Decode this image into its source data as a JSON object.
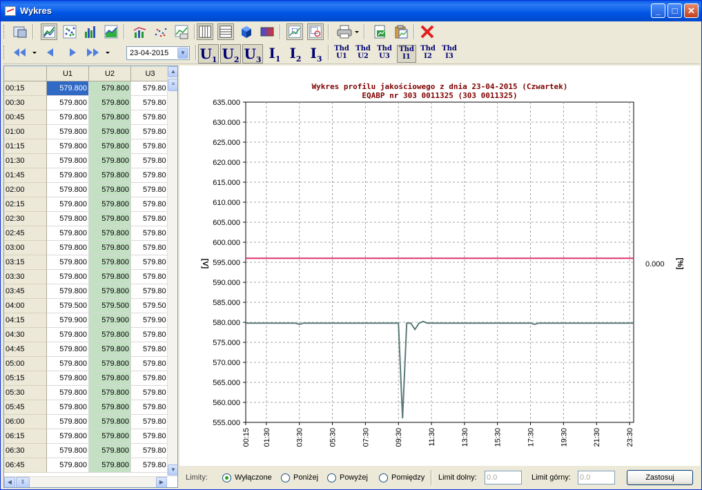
{
  "window": {
    "title": "Wykres"
  },
  "toolbar": {
    "date_value": "23-04-2015",
    "u_buttons": [
      {
        "main": "U",
        "sub": "1"
      },
      {
        "main": "U",
        "sub": "2"
      },
      {
        "main": "U",
        "sub": "3"
      },
      {
        "main": "I",
        "sub": "1"
      },
      {
        "main": "I",
        "sub": "2"
      },
      {
        "main": "I",
        "sub": "3"
      }
    ],
    "thd_buttons": [
      {
        "top": "Thd",
        "bottom": "U1"
      },
      {
        "top": "Thd",
        "bottom": "U2"
      },
      {
        "top": "Thd",
        "bottom": "U3"
      },
      {
        "top": "Thd",
        "bottom": "I1"
      },
      {
        "top": "Thd",
        "bottom": "I2"
      },
      {
        "top": "Thd",
        "bottom": "I3"
      }
    ]
  },
  "table": {
    "columns": [
      "",
      "U1",
      "U2",
      "U3"
    ],
    "rows": [
      {
        "time": "00:15",
        "u1": "579.800",
        "u2": "579.800",
        "u3": "579.80"
      },
      {
        "time": "00:30",
        "u1": "579.800",
        "u2": "579.800",
        "u3": "579.80"
      },
      {
        "time": "00:45",
        "u1": "579.800",
        "u2": "579.800",
        "u3": "579.80"
      },
      {
        "time": "01:00",
        "u1": "579.800",
        "u2": "579.800",
        "u3": "579.80"
      },
      {
        "time": "01:15",
        "u1": "579.800",
        "u2": "579.800",
        "u3": "579.80"
      },
      {
        "time": "01:30",
        "u1": "579.800",
        "u2": "579.800",
        "u3": "579.80"
      },
      {
        "time": "01:45",
        "u1": "579.800",
        "u2": "579.800",
        "u3": "579.80"
      },
      {
        "time": "02:00",
        "u1": "579.800",
        "u2": "579.800",
        "u3": "579.80"
      },
      {
        "time": "02:15",
        "u1": "579.800",
        "u2": "579.800",
        "u3": "579.80"
      },
      {
        "time": "02:30",
        "u1": "579.800",
        "u2": "579.800",
        "u3": "579.80"
      },
      {
        "time": "02:45",
        "u1": "579.800",
        "u2": "579.800",
        "u3": "579.80"
      },
      {
        "time": "03:00",
        "u1": "579.800",
        "u2": "579.800",
        "u3": "579.80"
      },
      {
        "time": "03:15",
        "u1": "579.800",
        "u2": "579.800",
        "u3": "579.80"
      },
      {
        "time": "03:30",
        "u1": "579.800",
        "u2": "579.800",
        "u3": "579.80"
      },
      {
        "time": "03:45",
        "u1": "579.800",
        "u2": "579.800",
        "u3": "579.80"
      },
      {
        "time": "04:00",
        "u1": "579.500",
        "u2": "579.500",
        "u3": "579.50"
      },
      {
        "time": "04:15",
        "u1": "579.900",
        "u2": "579.900",
        "u3": "579.90"
      },
      {
        "time": "04:30",
        "u1": "579.800",
        "u2": "579.800",
        "u3": "579.80"
      },
      {
        "time": "04:45",
        "u1": "579.800",
        "u2": "579.800",
        "u3": "579.80"
      },
      {
        "time": "05:00",
        "u1": "579.800",
        "u2": "579.800",
        "u3": "579.80"
      },
      {
        "time": "05:15",
        "u1": "579.800",
        "u2": "579.800",
        "u3": "579.80"
      },
      {
        "time": "05:30",
        "u1": "579.800",
        "u2": "579.800",
        "u3": "579.80"
      },
      {
        "time": "05:45",
        "u1": "579.800",
        "u2": "579.800",
        "u3": "579.80"
      },
      {
        "time": "06:00",
        "u1": "579.800",
        "u2": "579.800",
        "u3": "579.80"
      },
      {
        "time": "06:15",
        "u1": "579.800",
        "u2": "579.800",
        "u3": "579.80"
      },
      {
        "time": "06:30",
        "u1": "579.800",
        "u2": "579.800",
        "u3": "579.80"
      },
      {
        "time": "06:45",
        "u1": "579.800",
        "u2": "579.800",
        "u3": "579.80"
      }
    ]
  },
  "bottom": {
    "limits_label": "Limity:",
    "options": [
      "Wyłączone",
      "Poniżej",
      "Powyżej",
      "Pomiędzy"
    ],
    "selected": "Wyłączone",
    "lower_label": "Limit dolny:",
    "lower_value": "0.0",
    "upper_label": "Limit górny:",
    "upper_value": "0.0",
    "apply_label": "Zastosuj"
  },
  "chart_data": {
    "type": "line",
    "title": "Wykres profilu jakościowego z dnia 23-04-2015 (Czwartek)",
    "subtitle": "EQABP nr 303 0011325 (303 0011325)",
    "ylabel": "[V]",
    "y2label": "[%]",
    "y2_tick": "0.000",
    "ylim": [
      555,
      635
    ],
    "yticks": [
      "635.000",
      "630.000",
      "625.000",
      "620.000",
      "615.000",
      "610.000",
      "605.000",
      "600.000",
      "595.000",
      "590.000",
      "585.000",
      "580.000",
      "575.000",
      "570.000",
      "565.000",
      "560.000",
      "555.000"
    ],
    "xticks": [
      "00:15",
      "01:30",
      "03:30",
      "05:30",
      "07:30",
      "09:30",
      "11:30",
      "13:30",
      "15:30",
      "17:30",
      "19:30",
      "21:30",
      "23:30"
    ],
    "grid": true,
    "series": [
      {
        "color": "#5a7a78",
        "x": [
          "00:15",
          "03:15",
          "03:30",
          "03:45",
          "04:00",
          "09:30",
          "09:45",
          "10:00",
          "10:15",
          "10:30",
          "10:45",
          "11:00",
          "11:15",
          "11:30",
          "17:30",
          "17:45",
          "18:00",
          "23:45"
        ],
        "y": [
          579.8,
          579.8,
          579.5,
          579.8,
          579.8,
          579.8,
          556.0,
          579.8,
          579.8,
          578.2,
          579.8,
          580.2,
          579.8,
          579.8,
          579.8,
          579.5,
          579.8,
          579.8
        ]
      },
      {
        "color": "#e0306a",
        "x": [
          "00:15",
          "23:45"
        ],
        "y": [
          596.0,
          596.0
        ]
      }
    ]
  }
}
